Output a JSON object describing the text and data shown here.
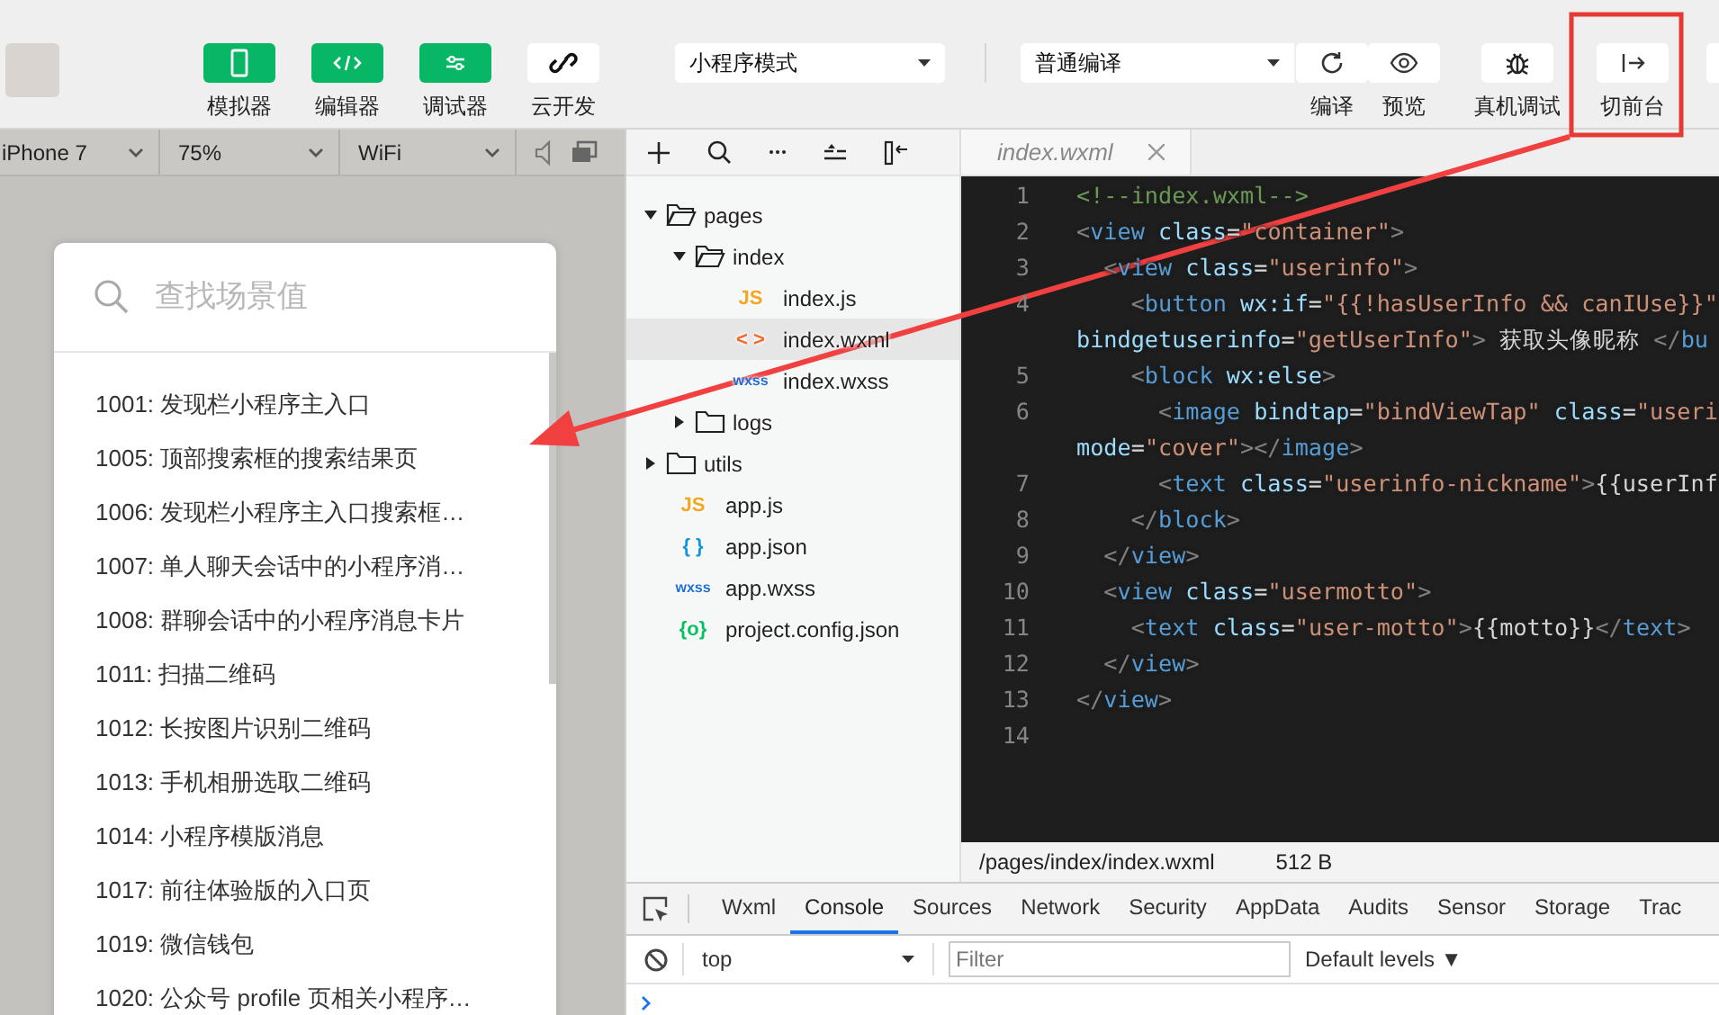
{
  "toolbar": {
    "toggles": [
      {
        "label": "模拟器",
        "on": true
      },
      {
        "label": "编辑器",
        "on": true
      },
      {
        "label": "调试器",
        "on": true
      },
      {
        "label": "云开发",
        "on": false
      }
    ],
    "mode_select": {
      "value": "小程序模式"
    },
    "compile_select": {
      "value": "普通编译"
    },
    "actions": [
      {
        "label": "编译"
      },
      {
        "label": "预览"
      },
      {
        "label": "真机调试"
      },
      {
        "label": "切前台",
        "highlighted": true
      }
    ]
  },
  "simulator": {
    "selects": [
      {
        "value": "iPhone 7"
      },
      {
        "value": "75%"
      },
      {
        "value": "WiFi"
      }
    ],
    "search": {
      "placeholder": "查找场景值"
    },
    "scenes": [
      "1001: 发现栏小程序主入口",
      "1005: 顶部搜索框的搜索结果页",
      "1006: 发现栏小程序主入口搜索框…",
      "1007: 单人聊天会话中的小程序消…",
      "1008: 群聊会话中的小程序消息卡片",
      "1011: 扫描二维码",
      "1012: 长按图片识别二维码",
      "1013: 手机相册选取二维码",
      "1014: 小程序模版消息",
      "1017: 前往体验版的入口页",
      "1019: 微信钱包",
      "1020: 公众号 profile 页相关小程序…"
    ]
  },
  "file_tree": [
    {
      "name": "pages",
      "kind": "folder",
      "expanded": true,
      "selected": false,
      "children": [
        {
          "name": "index",
          "kind": "folder",
          "expanded": true,
          "selected": false,
          "children": [
            {
              "name": "index.js",
              "kind": "js",
              "badge": "JS",
              "selected": false
            },
            {
              "name": "index.wxml",
              "kind": "wxml",
              "badge": "< >",
              "selected": true
            },
            {
              "name": "index.wxss",
              "kind": "wxss",
              "badge": "wxss",
              "selected": false
            }
          ]
        },
        {
          "name": "logs",
          "kind": "folder",
          "expanded": false,
          "selected": false
        }
      ]
    },
    {
      "name": "utils",
      "kind": "folder",
      "expanded": false,
      "selected": false
    },
    {
      "name": "app.js",
      "kind": "js",
      "badge": "JS",
      "selected": false
    },
    {
      "name": "app.json",
      "kind": "json",
      "badge": "{ }",
      "selected": false
    },
    {
      "name": "app.wxss",
      "kind": "wxss",
      "badge": "wxss",
      "selected": false
    },
    {
      "name": "project.config.json",
      "kind": "config",
      "badge": "{o}",
      "selected": false
    }
  ],
  "editor": {
    "tab": "index.wxml",
    "rows": [
      {
        "number": "1",
        "tokens": [
          {
            "kind": "comment",
            "text": "<!--index.wxml-->"
          }
        ]
      },
      {
        "number": "2",
        "tokens": [
          {
            "kind": "punct",
            "text": "<"
          },
          {
            "kind": "tag",
            "text": "view"
          },
          {
            "kind": "attr",
            "text": " class"
          },
          {
            "kind": "plain",
            "text": "="
          },
          {
            "kind": "string",
            "text": "\"container\""
          },
          {
            "kind": "punct",
            "text": ">"
          }
        ]
      },
      {
        "number": "3",
        "tokens": [
          {
            "kind": "punct",
            "text": "  <"
          },
          {
            "kind": "tag",
            "text": "view"
          },
          {
            "kind": "attr",
            "text": " class"
          },
          {
            "kind": "plain",
            "text": "="
          },
          {
            "kind": "string",
            "text": "\"userinfo\""
          },
          {
            "kind": "punct",
            "text": ">"
          }
        ]
      },
      {
        "number": "4",
        "tokens": [
          {
            "kind": "punct",
            "text": "    <"
          },
          {
            "kind": "tag",
            "text": "button"
          },
          {
            "kind": "attr",
            "text": " wx:if"
          },
          {
            "kind": "plain",
            "text": "="
          },
          {
            "kind": "string",
            "text": "\"{{!hasUserInfo && canIUse}}\""
          }
        ]
      },
      {
        "tokens": [
          {
            "kind": "attr",
            "text": "bindgetuserinfo"
          },
          {
            "kind": "plain",
            "text": "="
          },
          {
            "kind": "string",
            "text": "\"getUserInfo\""
          },
          {
            "kind": "punct",
            "text": ">"
          },
          {
            "kind": "plain",
            "text": " 获取头像昵称 "
          },
          {
            "kind": "punct",
            "text": "</"
          },
          {
            "kind": "tag",
            "text": "bu"
          }
        ]
      },
      {
        "number": "5",
        "tokens": [
          {
            "kind": "punct",
            "text": "    <"
          },
          {
            "kind": "tag",
            "text": "block"
          },
          {
            "kind": "attr",
            "text": " wx:else"
          },
          {
            "kind": "punct",
            "text": ">"
          }
        ]
      },
      {
        "number": "6",
        "tokens": [
          {
            "kind": "punct",
            "text": "      <"
          },
          {
            "kind": "tag",
            "text": "image"
          },
          {
            "kind": "attr",
            "text": " bindtap"
          },
          {
            "kind": "plain",
            "text": "="
          },
          {
            "kind": "string",
            "text": "\"bindViewTap\""
          },
          {
            "kind": "attr",
            "text": " class"
          },
          {
            "kind": "plain",
            "text": "="
          },
          {
            "kind": "string",
            "text": "\"useri"
          }
        ]
      },
      {
        "tokens": [
          {
            "kind": "attr",
            "text": "mode"
          },
          {
            "kind": "plain",
            "text": "="
          },
          {
            "kind": "string",
            "text": "\"cover\""
          },
          {
            "kind": "punct",
            "text": "></"
          },
          {
            "kind": "tag",
            "text": "image"
          },
          {
            "kind": "punct",
            "text": ">"
          }
        ]
      },
      {
        "number": "7",
        "tokens": [
          {
            "kind": "punct",
            "text": "      <"
          },
          {
            "kind": "tag",
            "text": "text"
          },
          {
            "kind": "attr",
            "text": " class"
          },
          {
            "kind": "plain",
            "text": "="
          },
          {
            "kind": "string",
            "text": "\"userinfo-nickname\""
          },
          {
            "kind": "punct",
            "text": ">"
          },
          {
            "kind": "plain",
            "text": "{{userInf"
          }
        ]
      },
      {
        "number": "8",
        "tokens": [
          {
            "kind": "punct",
            "text": "    </"
          },
          {
            "kind": "tag",
            "text": "block"
          },
          {
            "kind": "punct",
            "text": ">"
          }
        ]
      },
      {
        "number": "9",
        "tokens": [
          {
            "kind": "punct",
            "text": "  </"
          },
          {
            "kind": "tag",
            "text": "view"
          },
          {
            "kind": "punct",
            "text": ">"
          }
        ]
      },
      {
        "number": "10",
        "tokens": [
          {
            "kind": "punct",
            "text": "  <"
          },
          {
            "kind": "tag",
            "text": "view"
          },
          {
            "kind": "attr",
            "text": " class"
          },
          {
            "kind": "plain",
            "text": "="
          },
          {
            "kind": "string",
            "text": "\"usermotto\""
          },
          {
            "kind": "punct",
            "text": ">"
          }
        ]
      },
      {
        "number": "11",
        "tokens": [
          {
            "kind": "punct",
            "text": "    <"
          },
          {
            "kind": "tag",
            "text": "text"
          },
          {
            "kind": "attr",
            "text": " class"
          },
          {
            "kind": "plain",
            "text": "="
          },
          {
            "kind": "string",
            "text": "\"user-motto\""
          },
          {
            "kind": "punct",
            "text": ">"
          },
          {
            "kind": "plain",
            "text": "{{motto}}"
          },
          {
            "kind": "punct",
            "text": "</"
          },
          {
            "kind": "tag",
            "text": "text"
          },
          {
            "kind": "punct",
            "text": ">"
          }
        ]
      },
      {
        "number": "12",
        "tokens": [
          {
            "kind": "punct",
            "text": "  </"
          },
          {
            "kind": "tag",
            "text": "view"
          },
          {
            "kind": "punct",
            "text": ">"
          }
        ]
      },
      {
        "number": "13",
        "tokens": [
          {
            "kind": "punct",
            "text": "</"
          },
          {
            "kind": "tag",
            "text": "view"
          },
          {
            "kind": "punct",
            "text": ">"
          }
        ]
      },
      {
        "number": "14",
        "tokens": []
      }
    ],
    "status": {
      "path": "/pages/index/index.wxml",
      "size": "512 B"
    }
  },
  "devtools": {
    "tabs": [
      {
        "label": "Wxml",
        "selected": false
      },
      {
        "label": "Console",
        "selected": true
      },
      {
        "label": "Sources",
        "selected": false
      },
      {
        "label": "Network",
        "selected": false
      },
      {
        "label": "Security",
        "selected": false
      },
      {
        "label": "AppData",
        "selected": false
      },
      {
        "label": "Audits",
        "selected": false
      },
      {
        "label": "Sensor",
        "selected": false
      },
      {
        "label": "Storage",
        "selected": false
      },
      {
        "label": "Trac",
        "selected": false
      }
    ],
    "context": "top",
    "filter": {
      "placeholder": "Filter"
    },
    "levels": "Default levels ▼"
  }
}
